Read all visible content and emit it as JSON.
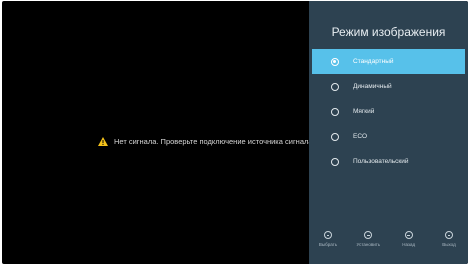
{
  "screen": {
    "no_signal_message": "Нет сигнала. Проверьте подключение источника сигнала"
  },
  "picture_mode_panel": {
    "title": "Режим изображения",
    "options": [
      {
        "label": "Стандартный",
        "selected": true
      },
      {
        "label": "Динамичный",
        "selected": false
      },
      {
        "label": "Мягкий",
        "selected": false
      },
      {
        "label": "ECO",
        "selected": false
      },
      {
        "label": "Пользовательский",
        "selected": false
      }
    ]
  },
  "footer": {
    "select": "Выбрать",
    "confirm": "Установить",
    "back": "Назад",
    "exit": "Выход"
  },
  "colors": {
    "panel_bg": "#2d4251",
    "highlight": "#57c1ea",
    "warning": "#f4c21b"
  },
  "icons": {
    "warning": "warning-triangle-icon",
    "radio": "radio-button-icon",
    "select": "select-button-icon",
    "confirm": "ok-button-icon",
    "back": "back-button-icon",
    "exit": "exit-button-icon"
  }
}
